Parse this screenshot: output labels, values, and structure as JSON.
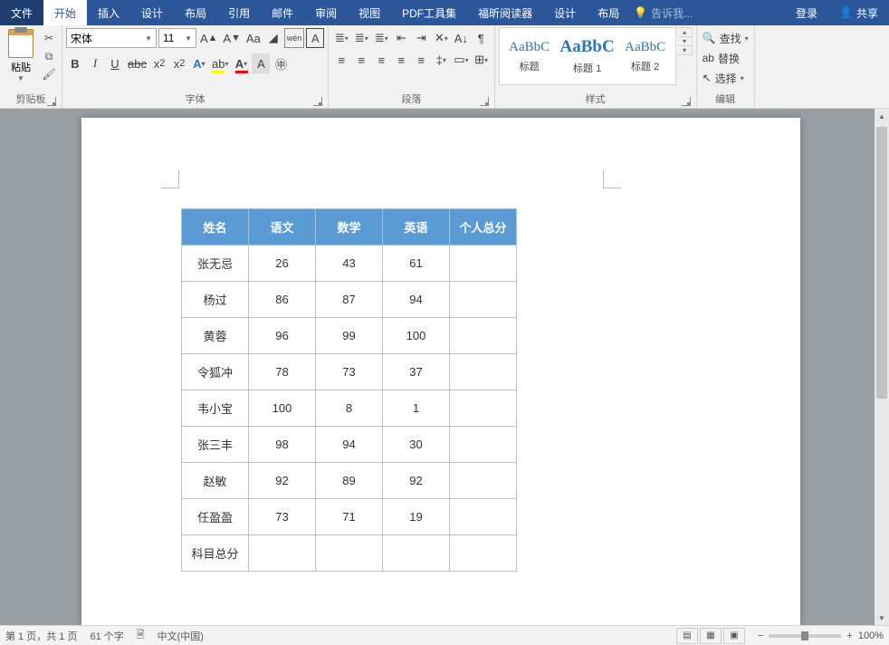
{
  "tabs": {
    "file": "文件",
    "home": "开始",
    "insert": "插入",
    "design": "设计",
    "layout": "布局",
    "references": "引用",
    "mailings": "邮件",
    "review": "审阅",
    "view": "视图",
    "pdf": "PDF工具集",
    "foxit": "福昕阅读器",
    "design2": "设计",
    "layout2": "布局",
    "tell_me": "告诉我...",
    "login": "登录",
    "share": "共享"
  },
  "ribbon": {
    "clipboard": {
      "label": "剪贴板",
      "paste": "粘贴"
    },
    "font": {
      "label": "字体",
      "name": "宋体",
      "size": "11",
      "buttons": {
        "bold": "B",
        "italic": "I",
        "underline": "U",
        "strike": "abc",
        "aa": "Aa",
        "wen": "wén",
        "boxA": "A"
      }
    },
    "paragraph": {
      "label": "段落"
    },
    "styles": {
      "label": "样式",
      "preview": "AaBbC",
      "items": [
        "标题",
        "标题 1",
        "标题 2"
      ]
    },
    "editing": {
      "label": "编辑",
      "find": "查找",
      "replace": "替换",
      "select": "选择"
    }
  },
  "table": {
    "headers": [
      "姓名",
      "语文",
      "数学",
      "英语",
      "个人总分"
    ],
    "rows": [
      [
        "张无忌",
        "26",
        "43",
        "61",
        ""
      ],
      [
        "杨过",
        "86",
        "87",
        "94",
        ""
      ],
      [
        "黄蓉",
        "96",
        "99",
        "100",
        ""
      ],
      [
        "令狐冲",
        "78",
        "73",
        "37",
        ""
      ],
      [
        "韦小宝",
        "100",
        "8",
        "1",
        ""
      ],
      [
        "张三丰",
        "98",
        "94",
        "30",
        ""
      ],
      [
        "赵敏",
        "92",
        "89",
        "92",
        ""
      ],
      [
        "任盈盈",
        "73",
        "71",
        "19",
        ""
      ],
      [
        "科目总分",
        "",
        "",
        "",
        ""
      ]
    ]
  },
  "status": {
    "page": "第 1 页，共 1 页",
    "words": "61 个字",
    "lang": "中文(中国)",
    "zoom": "100%"
  }
}
